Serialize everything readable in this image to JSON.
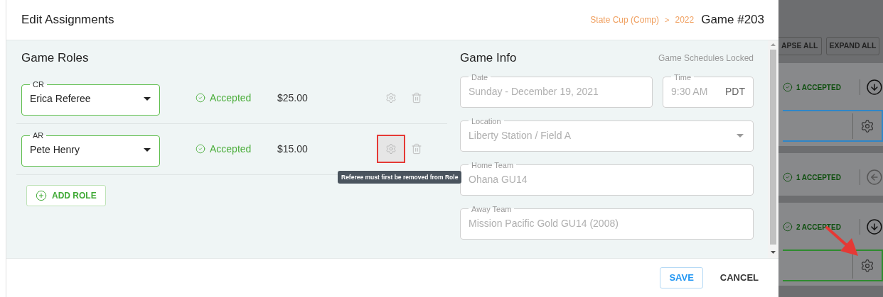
{
  "dialog": {
    "title": "Edit Assignments",
    "breadcrumb": [
      {
        "label": "State Cup (Comp)"
      },
      {
        "label": "2022"
      }
    ],
    "separator": ">",
    "game": "Game #203"
  },
  "roles": {
    "title": "Game Roles",
    "rows": [
      {
        "role": "CR",
        "referee": "Erica Referee",
        "status": "Accepted",
        "fee": "$25.00",
        "highlighted": false
      },
      {
        "role": "AR",
        "referee": "Pete Henry",
        "status": "Accepted",
        "fee": "$15.00",
        "highlighted": true
      }
    ],
    "tooltip": "Referee must first be removed from Role",
    "add_button": "ADD ROLE"
  },
  "info": {
    "title": "Game Info",
    "note": "Game Schedules Locked",
    "date": {
      "label": "Date",
      "value": "Sunday - December 19, 2021"
    },
    "time": {
      "label": "Time",
      "value": "9:30 AM",
      "zone": "PDT"
    },
    "location": {
      "label": "Location",
      "value": "Liberty Station / Field A"
    },
    "home_team": {
      "label": "Home Team",
      "value": "Ohana GU14"
    },
    "away_team": {
      "label": "Away Team",
      "value": "Mission Pacific Gold GU14 (2008)"
    }
  },
  "footer": {
    "buttons": [
      {
        "label": "SAVE",
        "kind": "primary"
      },
      {
        "label": "CANCEL",
        "kind": "text"
      }
    ]
  },
  "background": {
    "buttons": [
      "APSE ALL",
      "EXPAND ALL"
    ],
    "cards": [
      {
        "status": "1 ACCEPTED",
        "kind": "down",
        "color": "#2f86c8"
      },
      {
        "status": "1 ACCEPTED",
        "kind": "left"
      },
      {
        "status": "2 ACCEPTED",
        "kind": "down",
        "color": "#2e8b2e"
      }
    ]
  }
}
